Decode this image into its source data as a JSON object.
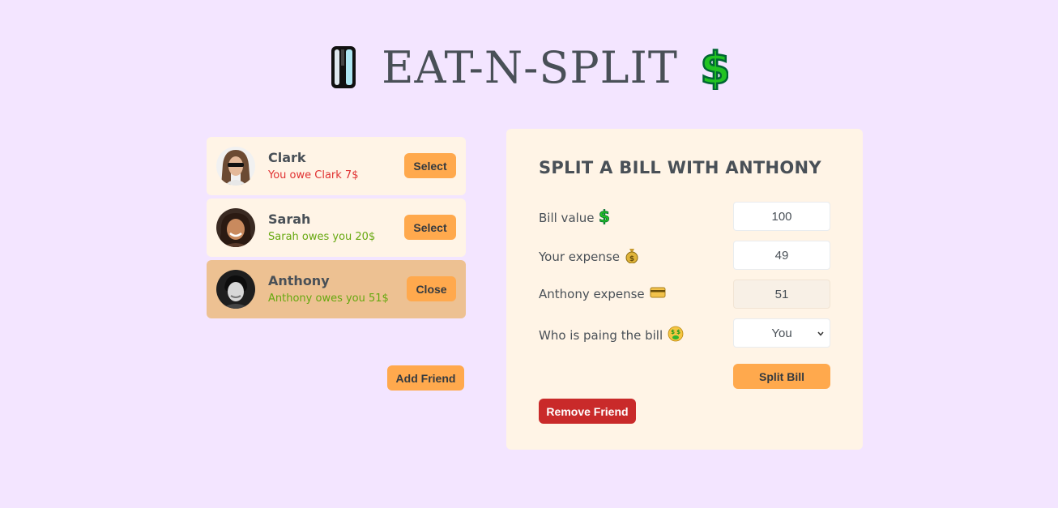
{
  "header": {
    "title": "EAT-N-SPLIT",
    "left_icon": "fork-icon",
    "right_icon": "dollar-icon"
  },
  "friends": [
    {
      "name": "Clark",
      "status": "You owe Clark 7$",
      "status_color": "#e03131",
      "button": "Select",
      "selected": false
    },
    {
      "name": "Sarah",
      "status": "Sarah owes you 20$",
      "status_color": "#66a80f",
      "button": "Select",
      "selected": false
    },
    {
      "name": "Anthony",
      "status": "Anthony owes you 51$",
      "status_color": "#66a80f",
      "button": "Close",
      "selected": true
    }
  ],
  "add_friend_label": "Add Friend",
  "split": {
    "title": "SPLIT A BILL WITH ANTHONY",
    "bill_label": "Bill value",
    "bill_value": "100",
    "your_expense_label": "Your expense",
    "your_expense_value": "49",
    "friend_expense_label": "Anthony expense",
    "friend_expense_value": "51",
    "payer_label": "Who is paing the bill",
    "payer_value": "You",
    "payer_options": [
      "You"
    ],
    "split_button": "Split Bill",
    "remove_button": "Remove Friend"
  },
  "colors": {
    "background": "#f3e5ff",
    "card": "#fff4e6",
    "selected": "#edc192",
    "accent": "#ffa94d",
    "danger": "#c92a2a"
  }
}
